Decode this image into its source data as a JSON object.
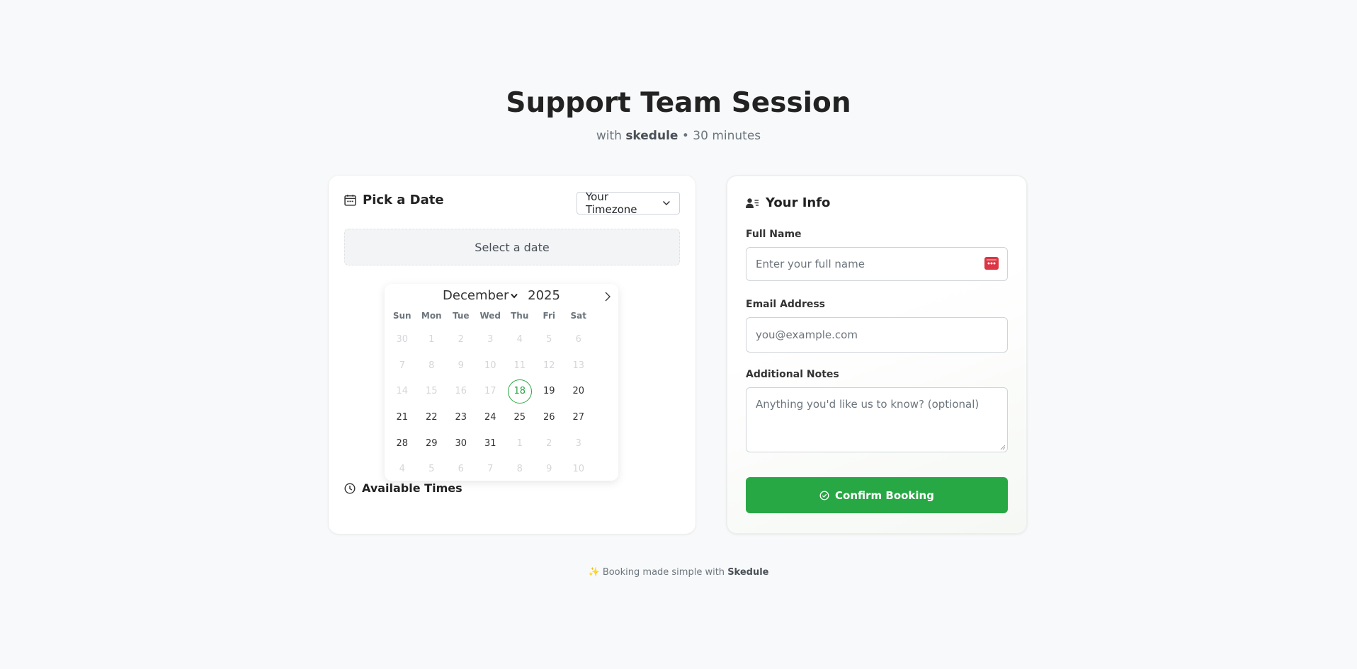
{
  "header": {
    "title": "Support Team Session",
    "subtitle_prefix": "with",
    "host": "skedule",
    "separator": "•",
    "duration": "30 minutes"
  },
  "pick_date": {
    "heading": "Pick a Date",
    "timezone_label": "Your Timezone",
    "selected_date_placeholder": "Select a date",
    "calendar": {
      "month": "December",
      "year": "2025",
      "weekdays": [
        "Sun",
        "Mon",
        "Tue",
        "Wed",
        "Thu",
        "Fri",
        "Sat"
      ],
      "weeks": [
        [
          "30",
          "1",
          "2",
          "3",
          "4",
          "5",
          "6"
        ],
        [
          "7",
          "8",
          "9",
          "10",
          "11",
          "12",
          "13"
        ],
        [
          "14",
          "15",
          "16",
          "17",
          "18",
          "19",
          "20"
        ],
        [
          "21",
          "22",
          "23",
          "24",
          "25",
          "26",
          "27"
        ],
        [
          "28",
          "29",
          "30",
          "31",
          "1",
          "2",
          "3"
        ],
        [
          "4",
          "5",
          "6",
          "7",
          "8",
          "9",
          "10"
        ]
      ],
      "disabled_days": [
        0,
        1,
        2,
        3,
        4,
        5,
        6,
        7,
        8,
        9,
        10,
        11,
        12,
        13,
        14,
        15,
        16,
        17,
        32,
        33,
        34,
        35,
        36,
        37,
        38,
        39,
        40,
        41
      ],
      "today_index": 18
    },
    "times_heading": "Available Times"
  },
  "your_info": {
    "heading": "Your Info",
    "full_name_label": "Full Name",
    "full_name_placeholder": "Enter your full name",
    "email_label": "Email Address",
    "email_placeholder": "you@example.com",
    "notes_label": "Additional Notes",
    "notes_placeholder": "Anything you'd like us to know? (optional)",
    "confirm_label": "Confirm Booking"
  },
  "footer": {
    "sparkle": "✨",
    "text": "Booking made simple with",
    "brand": "Skedule"
  },
  "colors": {
    "accent": "#28a745",
    "autofill_icon": "#dc3545"
  }
}
